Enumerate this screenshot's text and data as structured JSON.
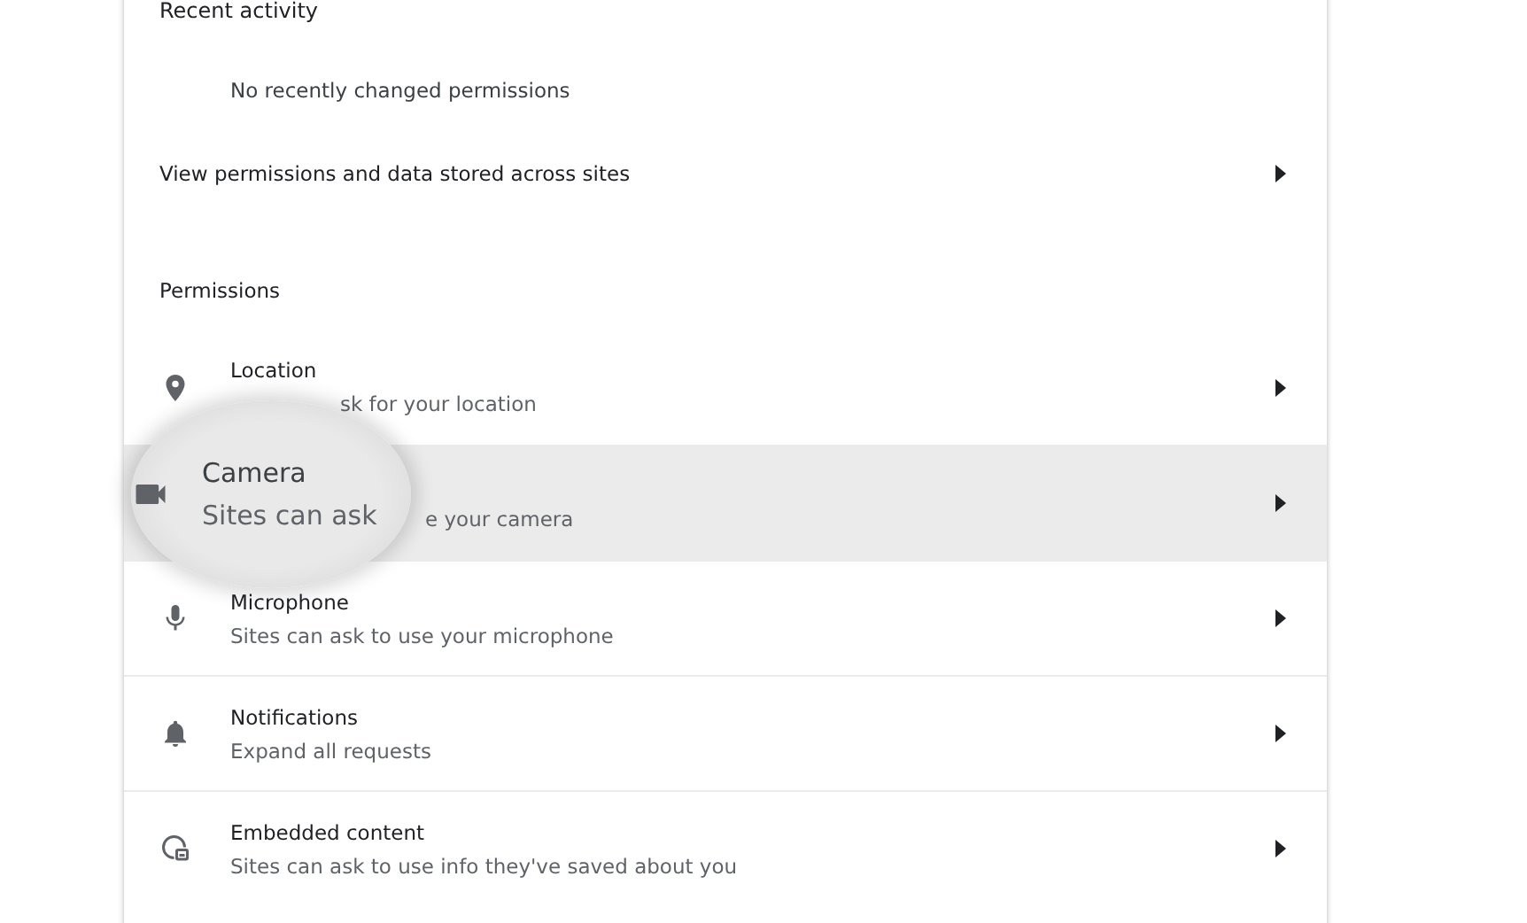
{
  "recent_activity": {
    "heading": "Recent activity",
    "empty_message": "No recently changed permissions"
  },
  "view_link": {
    "label": "View permissions and data stored across sites"
  },
  "permissions": {
    "heading": "Permissions",
    "rows": [
      {
        "kind": "location",
        "title": "Location",
        "subtitle": "sk for your location",
        "covered": true,
        "highlighted": false
      },
      {
        "kind": "camera",
        "subtitle": "e your camera",
        "covered": true,
        "highlighted": true,
        "magnifier": {
          "title": "Camera",
          "subtitle": "Sites can ask"
        }
      },
      {
        "kind": "microphone",
        "title": "Microphone",
        "subtitle": "Sites can ask to use your microphone",
        "highlighted": false
      },
      {
        "kind": "bell",
        "title": "Notifications",
        "subtitle": "Expand all requests",
        "highlighted": false
      },
      {
        "kind": "embedded",
        "title": "Embedded content",
        "subtitle": "Sites can ask to use info they've saved about you",
        "highlighted": false
      }
    ]
  }
}
